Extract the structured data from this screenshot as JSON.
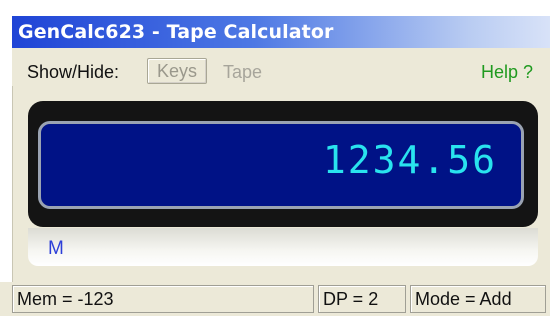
{
  "window": {
    "title": "GenCalc623 - Tape Calculator"
  },
  "toolbar": {
    "show_hide_label": "Show/Hide:",
    "keys_label": "Keys",
    "tape_label": "Tape",
    "help_label": "Help ?"
  },
  "display": {
    "value": "1234.56",
    "memory_indicator": "M"
  },
  "status": {
    "mem": "Mem = -123",
    "dp": "DP = 2",
    "mode": "Mode = Add"
  },
  "colors": {
    "titlebar": "#1f44d6",
    "lcd_background": "#001286",
    "lcd_text": "#29e3ee",
    "help_link": "#1f9a1f",
    "memory_indicator": "#2d3fd8"
  }
}
